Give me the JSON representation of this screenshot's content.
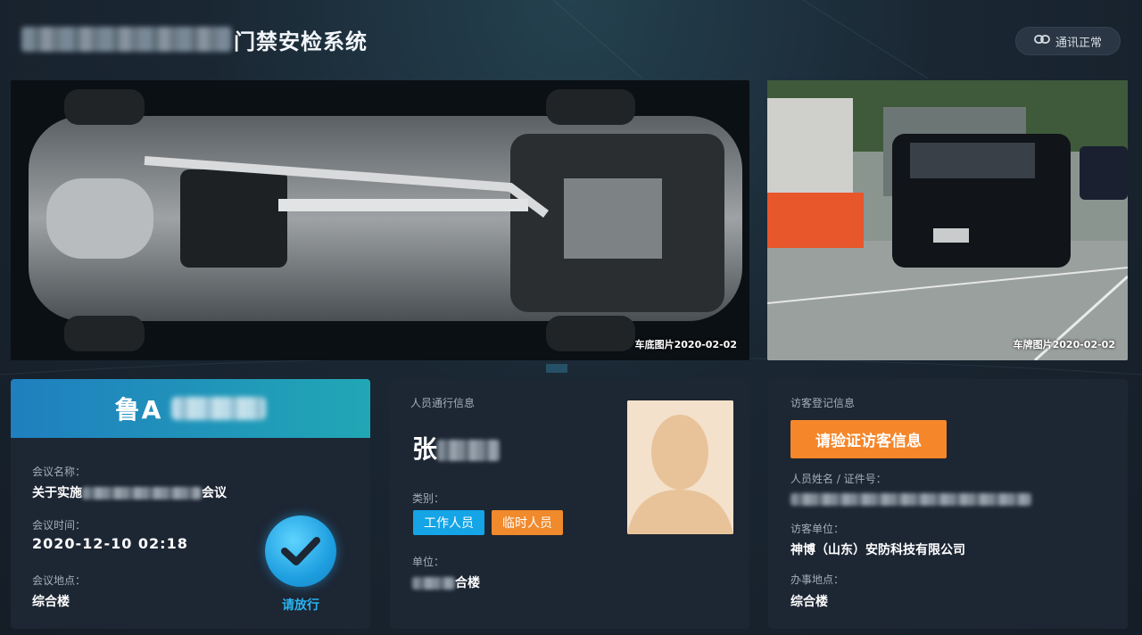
{
  "header": {
    "title_suffix": "门禁安检系统",
    "status_label": "通讯正常"
  },
  "images": {
    "underbody_caption": "车底图片2020-02-02",
    "plate_caption": "车牌图片2020-02-02"
  },
  "meeting": {
    "plate_prefix": "鲁A",
    "name_label": "会议名称：",
    "name_prefix": "关于实施",
    "name_suffix": "会议",
    "time_label": "会议时间：",
    "time_value": "2020-12-10 02:18",
    "place_label": "会议地点：",
    "place_value": "综合楼",
    "pass_label": "请放行"
  },
  "person": {
    "section_title": "人员通行信息",
    "name_prefix": "张",
    "category_label": "类别：",
    "tags": [
      "工作人员",
      "临时人员"
    ],
    "unit_label": "单位：",
    "unit_suffix": "合楼"
  },
  "visitor": {
    "section_title": "访客登记信息",
    "verify_button": "请验证访客信息",
    "id_label": "人员姓名 / 证件号：",
    "company_label": "访客单位：",
    "company_value": "神博（山东）安防科技有限公司",
    "place_label": "办事地点：",
    "place_value": "综合楼"
  },
  "colors": {
    "accent_blue": "#15a4e6",
    "accent_orange": "#f5862a",
    "card_bg": "#1d2633"
  }
}
